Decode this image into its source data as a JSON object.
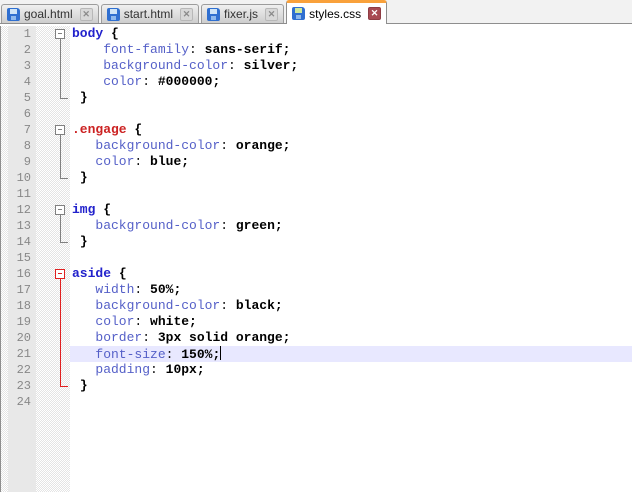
{
  "tabbar": {
    "tabs": [
      {
        "label": "goal.html",
        "active": false
      },
      {
        "label": "start.html",
        "active": false
      },
      {
        "label": "fixer.js",
        "active": false
      },
      {
        "label": "styles.css",
        "active": true
      }
    ],
    "close_glyph": "✕"
  },
  "colors": {
    "active_tab_accent": "#F9A13B",
    "active_close_bg": "#A84A52",
    "fold_normal": "#808080",
    "fold_active": "#E02020",
    "selector_element": "#2222CC",
    "selector_class": "#CC2222",
    "property": "#5560C8",
    "current_line_bg": "#E8E8FF",
    "line_number": "#888888"
  },
  "editor": {
    "language": "css",
    "lines": [
      {
        "num": 1,
        "fold": "start",
        "foldStyle": "normal",
        "segments": [
          [
            "el",
            "body"
          ],
          [
            "plain",
            " "
          ],
          [
            "brace",
            "{"
          ]
        ]
      },
      {
        "num": 2,
        "fold": "mid",
        "foldStyle": "normal",
        "segments": [
          [
            "plain",
            "    "
          ],
          [
            "prop",
            "font-family"
          ],
          [
            "colon",
            ":"
          ],
          [
            "plain",
            " "
          ],
          [
            "val",
            "sans-serif;"
          ]
        ]
      },
      {
        "num": 3,
        "fold": "mid",
        "foldStyle": "normal",
        "segments": [
          [
            "plain",
            "    "
          ],
          [
            "prop",
            "background-color"
          ],
          [
            "colon",
            ":"
          ],
          [
            "plain",
            " "
          ],
          [
            "val",
            "silver;"
          ]
        ]
      },
      {
        "num": 4,
        "fold": "mid",
        "foldStyle": "normal",
        "segments": [
          [
            "plain",
            "    "
          ],
          [
            "prop",
            "color"
          ],
          [
            "colon",
            ":"
          ],
          [
            "plain",
            " "
          ],
          [
            "val",
            "#000000;"
          ]
        ]
      },
      {
        "num": 5,
        "fold": "end",
        "foldStyle": "normal",
        "segments": [
          [
            "plain",
            " "
          ],
          [
            "brace",
            "}"
          ]
        ]
      },
      {
        "num": 6,
        "fold": "none",
        "segments": []
      },
      {
        "num": 7,
        "fold": "start",
        "foldStyle": "normal",
        "segments": [
          [
            "cls",
            ".engage"
          ],
          [
            "plain",
            " "
          ],
          [
            "brace",
            "{"
          ]
        ]
      },
      {
        "num": 8,
        "fold": "mid",
        "foldStyle": "normal",
        "segments": [
          [
            "plain",
            "   "
          ],
          [
            "prop",
            "background-color"
          ],
          [
            "colon",
            ":"
          ],
          [
            "plain",
            " "
          ],
          [
            "val",
            "orange;"
          ]
        ]
      },
      {
        "num": 9,
        "fold": "mid",
        "foldStyle": "normal",
        "segments": [
          [
            "plain",
            "   "
          ],
          [
            "prop",
            "color"
          ],
          [
            "colon",
            ":"
          ],
          [
            "plain",
            " "
          ],
          [
            "val",
            "blue;"
          ]
        ]
      },
      {
        "num": 10,
        "fold": "end",
        "foldStyle": "normal",
        "segments": [
          [
            "plain",
            " "
          ],
          [
            "brace",
            "}"
          ]
        ]
      },
      {
        "num": 11,
        "fold": "none",
        "segments": []
      },
      {
        "num": 12,
        "fold": "start",
        "foldStyle": "normal",
        "segments": [
          [
            "el",
            "img"
          ],
          [
            "plain",
            " "
          ],
          [
            "brace",
            "{"
          ]
        ]
      },
      {
        "num": 13,
        "fold": "mid",
        "foldStyle": "normal",
        "segments": [
          [
            "plain",
            "   "
          ],
          [
            "prop",
            "background-color"
          ],
          [
            "colon",
            ":"
          ],
          [
            "plain",
            " "
          ],
          [
            "val",
            "green;"
          ]
        ]
      },
      {
        "num": 14,
        "fold": "end",
        "foldStyle": "normal",
        "segments": [
          [
            "plain",
            " "
          ],
          [
            "brace",
            "}"
          ]
        ]
      },
      {
        "num": 15,
        "fold": "none",
        "segments": []
      },
      {
        "num": 16,
        "fold": "start",
        "foldStyle": "active",
        "segments": [
          [
            "el",
            "aside"
          ],
          [
            "plain",
            " "
          ],
          [
            "brace",
            "{"
          ]
        ]
      },
      {
        "num": 17,
        "fold": "mid",
        "foldStyle": "active",
        "segments": [
          [
            "plain",
            "   "
          ],
          [
            "prop",
            "width"
          ],
          [
            "colon",
            ":"
          ],
          [
            "plain",
            " "
          ],
          [
            "val",
            "50%;"
          ]
        ]
      },
      {
        "num": 18,
        "fold": "mid",
        "foldStyle": "active",
        "segments": [
          [
            "plain",
            "   "
          ],
          [
            "prop",
            "background-color"
          ],
          [
            "colon",
            ":"
          ],
          [
            "plain",
            " "
          ],
          [
            "val",
            "black;"
          ]
        ]
      },
      {
        "num": 19,
        "fold": "mid",
        "foldStyle": "active",
        "segments": [
          [
            "plain",
            "   "
          ],
          [
            "prop",
            "color"
          ],
          [
            "colon",
            ":"
          ],
          [
            "plain",
            " "
          ],
          [
            "val",
            "white;"
          ]
        ]
      },
      {
        "num": 20,
        "fold": "mid",
        "foldStyle": "active",
        "segments": [
          [
            "plain",
            "   "
          ],
          [
            "prop",
            "border"
          ],
          [
            "colon",
            ":"
          ],
          [
            "plain",
            " "
          ],
          [
            "val",
            "3px solid orange;"
          ]
        ]
      },
      {
        "num": 21,
        "fold": "mid",
        "foldStyle": "active",
        "current": true,
        "caret": true,
        "segments": [
          [
            "plain",
            "   "
          ],
          [
            "prop",
            "font-size"
          ],
          [
            "colon",
            ":"
          ],
          [
            "plain",
            " "
          ],
          [
            "val",
            "150%;"
          ]
        ]
      },
      {
        "num": 22,
        "fold": "mid",
        "foldStyle": "active",
        "segments": [
          [
            "plain",
            "   "
          ],
          [
            "prop",
            "padding"
          ],
          [
            "colon",
            ":"
          ],
          [
            "plain",
            " "
          ],
          [
            "val",
            "10px;"
          ]
        ]
      },
      {
        "num": 23,
        "fold": "end",
        "foldStyle": "active",
        "segments": [
          [
            "plain",
            " "
          ],
          [
            "brace",
            "}"
          ]
        ]
      },
      {
        "num": 24,
        "fold": "none",
        "segments": []
      }
    ]
  }
}
